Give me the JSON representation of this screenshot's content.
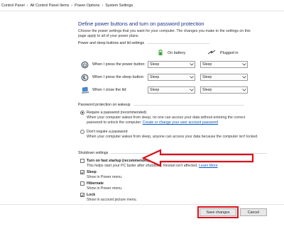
{
  "breadcrumb": {
    "items": [
      "Control Panel",
      "All Control Panel Items",
      "Power Options",
      "System Settings"
    ]
  },
  "page": {
    "title": "Define power buttons and turn on password protection",
    "description": "Choose the power settings that you want for your computer. The changes you make to the settings on this page apply to all of your power plans."
  },
  "power_section": {
    "heading": "Power and sleep buttons and lid settings",
    "col_battery": "On battery",
    "col_plugged": "Plugged in",
    "rows": [
      {
        "label": "When I press the power button:",
        "battery": "Sleep",
        "plugged": "Sleep",
        "icon": "power-icon"
      },
      {
        "label": "When I press the sleep button:",
        "battery": "Sleep",
        "plugged": "Sleep",
        "icon": "sleep-icon"
      },
      {
        "label": "When I close the lid:",
        "battery": "Sleep",
        "plugged": "Sleep",
        "icon": "laptop-lid-icon"
      }
    ]
  },
  "password_section": {
    "heading": "Password protection on wakeup",
    "require_label": "Require a password (recommended)",
    "require_desc": "When your computer wakes from sleep, no one can access your data without entering the correct password to unlock the computer.",
    "require_link": "Create or change your user account password",
    "norequire_label": "Don't require a password",
    "norequire_desc": "When your computer wakes from sleep, anyone can access your data because the computer isn't locked.",
    "selected": "require"
  },
  "shutdown_section": {
    "heading": "Shutdown settings",
    "fast_startup_label": "Turn on fast startup (recommended)",
    "fast_startup_desc": "This helps start your PC faster after shutdown. Restart isn't affected.",
    "fast_startup_link": "Learn More",
    "fast_startup_checked": false,
    "sleep_label": "Sleep",
    "sleep_desc": "Show in Power menu.",
    "sleep_checked": true,
    "hibernate_label": "Hibernate",
    "hibernate_desc": "Show in Power menu.",
    "hibernate_checked": false,
    "lock_label": "Lock",
    "lock_desc": "Show in account picture menu.",
    "lock_checked": true
  },
  "buttons": {
    "save": "Save changes",
    "cancel": "Cancel"
  },
  "colors": {
    "title": "#1e3287",
    "link": "#0a5bc4",
    "annotation": "#d9121b",
    "battery_icon": "#2f9e2f"
  }
}
